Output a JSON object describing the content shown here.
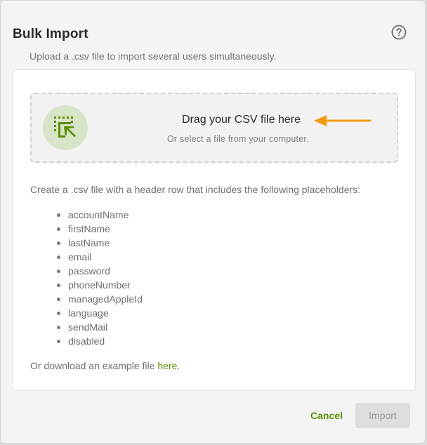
{
  "dialog": {
    "title": "Bulk Import",
    "subtitle": "Upload a .csv file to import several users simultaneously.",
    "help_icon": "question-circle-icon"
  },
  "dropzone": {
    "icon": "select-file-cursor-icon",
    "title": "Drag your CSV file here",
    "subtitle": "Or select a file from your computer.",
    "annotation_icon": "left-arrow-icon"
  },
  "instructions": {
    "text": "Create a .csv file with a header row that includes the following placeholders:",
    "placeholders": [
      "accountName",
      "firstName",
      "lastName",
      "email",
      "password",
      "phoneNumber",
      "managedAppleId",
      "language",
      "sendMail",
      "disabled"
    ],
    "download_prefix": "Or download an example file ",
    "download_link": "here."
  },
  "footer": {
    "cancel_label": "Cancel",
    "import_label": "Import"
  },
  "colors": {
    "accent_green": "#5a8f00",
    "annotation_orange": "#f39c12",
    "icon_circle_bg": "#d8e4c8"
  }
}
